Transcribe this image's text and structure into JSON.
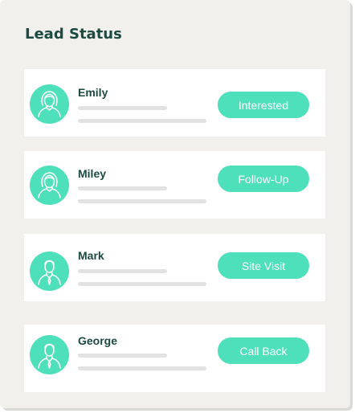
{
  "header": {
    "title": "Lead Status"
  },
  "colors": {
    "accent": "#4ee0ba",
    "title": "#1c4a40",
    "panel": "#f1f0ed"
  },
  "leads": [
    {
      "name": "Emily",
      "status": "Interested",
      "avatar_icon": "female-avatar-icon"
    },
    {
      "name": "Miley",
      "status": "Follow-Up",
      "avatar_icon": "female-avatar-icon"
    },
    {
      "name": "Mark",
      "status": "Site Visit",
      "avatar_icon": "male-avatar-icon"
    },
    {
      "name": "George",
      "status": "Call Back",
      "avatar_icon": "male-avatar-icon"
    }
  ]
}
